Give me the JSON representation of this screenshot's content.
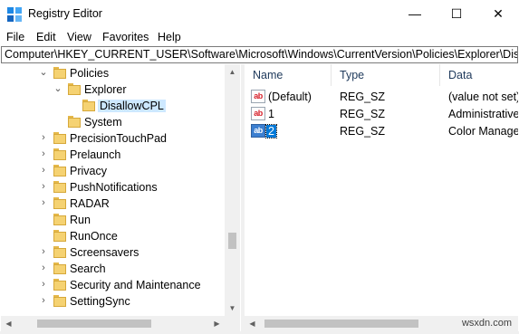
{
  "window": {
    "title": "Registry Editor",
    "minimize": "—",
    "maximize": "☐",
    "close": "✕"
  },
  "menu": {
    "file": "File",
    "edit": "Edit",
    "view": "View",
    "favorites": "Favorites",
    "help": "Help"
  },
  "address": "Computer\\HKEY_CURRENT_USER\\Software\\Microsoft\\Windows\\CurrentVersion\\Policies\\Explorer\\Disallow",
  "tree": [
    {
      "label": "Policies",
      "chevron": "⌄"
    },
    {
      "label": "Explorer",
      "chevron": "⌄"
    },
    {
      "label": "DisallowCPL",
      "chevron": ""
    },
    {
      "label": "System",
      "chevron": ""
    },
    {
      "label": "PrecisionTouchPad",
      "chevron": "›"
    },
    {
      "label": "Prelaunch",
      "chevron": "›"
    },
    {
      "label": "Privacy",
      "chevron": "›"
    },
    {
      "label": "PushNotifications",
      "chevron": "›"
    },
    {
      "label": "RADAR",
      "chevron": "›"
    },
    {
      "label": "Run",
      "chevron": ""
    },
    {
      "label": "RunOnce",
      "chevron": ""
    },
    {
      "label": "Screensavers",
      "chevron": "›"
    },
    {
      "label": "Search",
      "chevron": "›"
    },
    {
      "label": "Security and Maintenance",
      "chevron": "›"
    },
    {
      "label": "SettingSync",
      "chevron": "›"
    }
  ],
  "columns": {
    "name": "Name",
    "type": "Type",
    "data": "Data"
  },
  "values": [
    {
      "name": "(Default)",
      "type": "REG_SZ",
      "data": "(value not set)",
      "icon": "ab"
    },
    {
      "name": "1",
      "type": "REG_SZ",
      "data": "Administrative",
      "icon": "ab"
    },
    {
      "name": "2",
      "type": "REG_SZ",
      "data": "Color Manage",
      "icon": "ab"
    }
  ],
  "watermark": "wsxdn.com",
  "colors": {
    "selection": "#0078d7",
    "tree_selection": "#cde8ff",
    "folder": "#f5d272"
  }
}
